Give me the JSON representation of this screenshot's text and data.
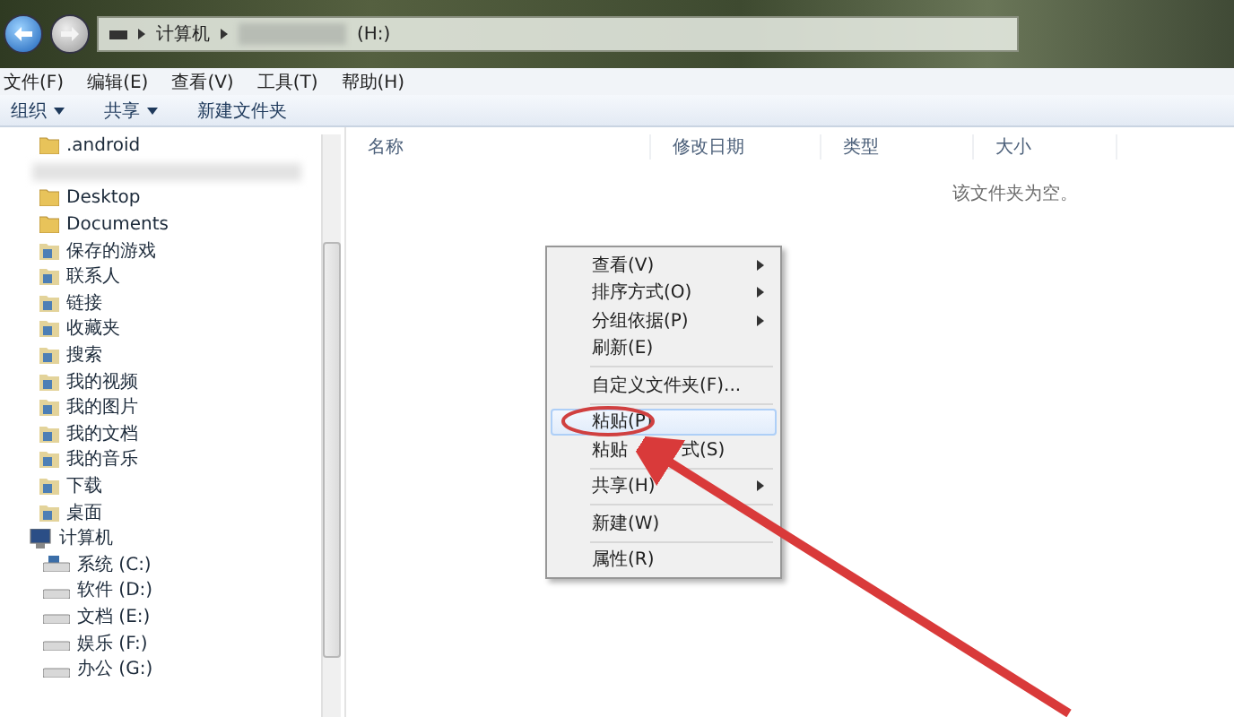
{
  "address_bar": {
    "segments": [
      "计算机"
    ],
    "drive": "(H:)"
  },
  "menu_bar": [
    "文件(F)",
    "编辑(E)",
    "查看(V)",
    "工具(T)",
    "帮助(H)"
  ],
  "toolbar": [
    {
      "label": "组织",
      "dropdown": true
    },
    {
      "label": "共享",
      "dropdown": true
    },
    {
      "label": "新建文件夹",
      "dropdown": false
    }
  ],
  "nav_pane": {
    "items": [
      {
        "label": ".android",
        "kind": "folder"
      },
      {
        "kind": "blurred"
      },
      {
        "label": "Desktop",
        "kind": "folder"
      },
      {
        "label": "Documents",
        "kind": "folder"
      },
      {
        "label": "保存的游戏",
        "kind": "special"
      },
      {
        "label": "联系人",
        "kind": "special"
      },
      {
        "label": "链接",
        "kind": "special"
      },
      {
        "label": "收藏夹",
        "kind": "special"
      },
      {
        "label": "搜索",
        "kind": "special"
      },
      {
        "label": "我的视频",
        "kind": "special"
      },
      {
        "label": "我的图片",
        "kind": "special"
      },
      {
        "label": "我的文档",
        "kind": "special"
      },
      {
        "label": "我的音乐",
        "kind": "special"
      },
      {
        "label": "下载",
        "kind": "special"
      },
      {
        "label": "桌面",
        "kind": "special"
      },
      {
        "label": "计算机",
        "kind": "computer",
        "children": [
          {
            "label": "系统 (C:)",
            "kind": "sysdrive"
          },
          {
            "label": "软件 (D:)",
            "kind": "drive"
          },
          {
            "label": "文档 (E:)",
            "kind": "drive"
          },
          {
            "label": "娱乐 (F:)",
            "kind": "drive"
          },
          {
            "label": "办公 (G:)",
            "kind": "drive"
          }
        ]
      }
    ]
  },
  "columns": [
    "名称",
    "修改日期",
    "类型",
    "大小"
  ],
  "empty_message": "该文件夹为空。",
  "context_menu": [
    {
      "kind": "item",
      "label": "查看(V)",
      "submenu": true,
      "selected": false
    },
    {
      "kind": "item",
      "label": "排序方式(O)",
      "submenu": true,
      "selected": false
    },
    {
      "kind": "item",
      "label": "分组依据(P)",
      "submenu": true,
      "selected": false
    },
    {
      "kind": "item",
      "label": "刷新(E)",
      "submenu": false,
      "selected": false
    },
    {
      "kind": "separator"
    },
    {
      "kind": "item",
      "label": "自定义文件夹(F)...",
      "submenu": false,
      "selected": false
    },
    {
      "kind": "separator"
    },
    {
      "kind": "item",
      "label": "粘贴(P)",
      "submenu": false,
      "selected": true,
      "circled": true
    },
    {
      "kind": "item",
      "label": "粘贴",
      "label_after_arrow": "式(S)",
      "submenu": false,
      "selected": false
    },
    {
      "kind": "separator"
    },
    {
      "kind": "item",
      "label": "共享(H)",
      "submenu": true,
      "selected": false
    },
    {
      "kind": "separator"
    },
    {
      "kind": "item",
      "label": "新建(W)",
      "submenu": false,
      "selected": false
    },
    {
      "kind": "separator"
    },
    {
      "kind": "item",
      "label": "属性(R)",
      "submenu": false,
      "selected": false
    }
  ]
}
